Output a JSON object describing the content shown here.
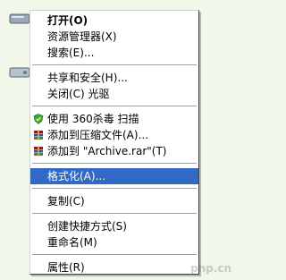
{
  "menu": {
    "items": [
      {
        "label": "打开(O)",
        "bold": true
      },
      {
        "label": "资源管理器(X)"
      },
      {
        "label": "搜索(E)..."
      },
      {
        "label": "共享和安全(H)..."
      },
      {
        "label": "关闭(C) 光驱"
      },
      {
        "label": "使用 360杀毒 扫描",
        "icon": "shield-icon"
      },
      {
        "label": "添加到压缩文件(A)...",
        "icon": "archive-icon"
      },
      {
        "label": "添加到 \"Archive.rar\"(T)",
        "icon": "archive-icon"
      },
      {
        "label": "格式化(A)...",
        "highlighted": true
      },
      {
        "label": "复制(C)"
      },
      {
        "label": "创建快捷方式(S)"
      },
      {
        "label": "重命名(M)"
      },
      {
        "label": "属性(R)"
      }
    ]
  },
  "watermark": "php.cn",
  "colors": {
    "highlight": "#316ac5",
    "background": "#f1f8e9"
  }
}
